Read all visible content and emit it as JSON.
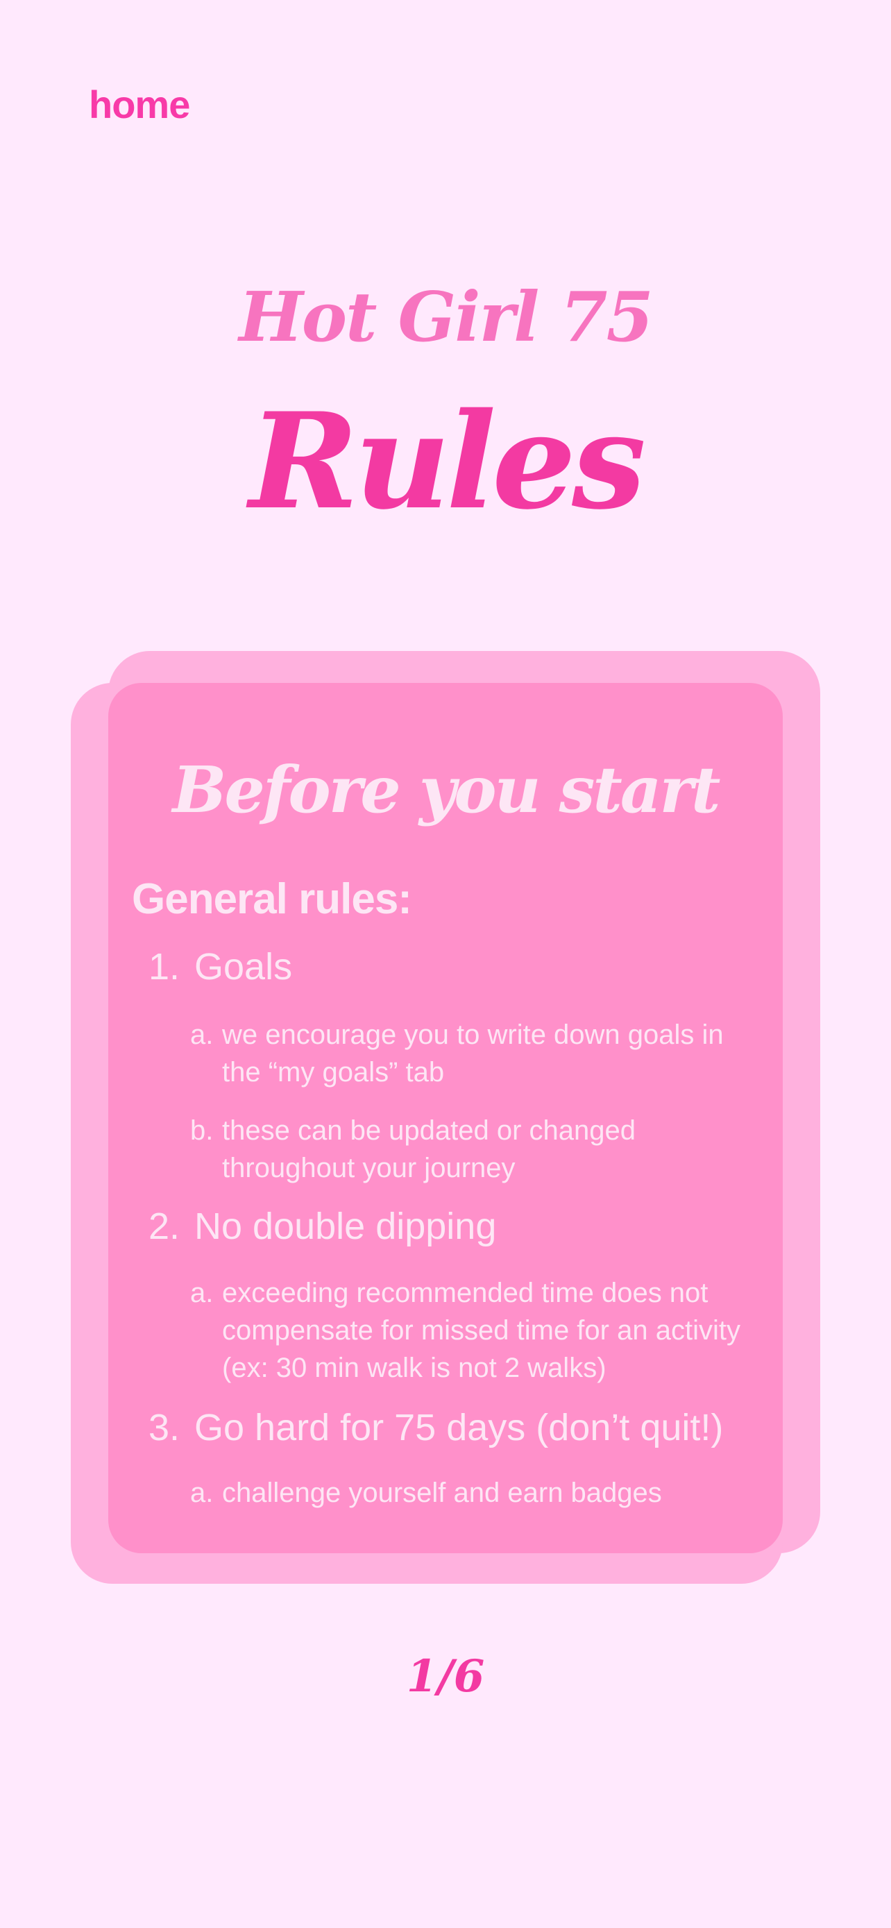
{
  "nav": {
    "home_label": "home"
  },
  "header": {
    "subtitle": "Hot Girl 75",
    "title": "Rules"
  },
  "card": {
    "heading": "Before you start",
    "section_title": "General rules:",
    "rules": [
      {
        "number": "1.",
        "label": "Goals",
        "subs": [
          {
            "letter": "a.",
            "text": "we encourage you to write down goals in the “my goals” tab"
          },
          {
            "letter": "b.",
            "text": "these can be updated or changed throughout your journey"
          }
        ]
      },
      {
        "number": "2.",
        "label": "No double dipping",
        "subs": [
          {
            "letter": "a.",
            "text": "exceeding recommended time does not compensate for missed time for an activity (ex: 30 min walk is not 2 walks)"
          }
        ]
      },
      {
        "number": "3.",
        "label": "Go hard for 75 days (don’t quit!)",
        "subs": [
          {
            "letter": "a.",
            "text": "challenge yourself and earn badges"
          }
        ]
      }
    ]
  },
  "pagination": {
    "indicator": "1/6"
  },
  "colors": {
    "background": "#ffe9fd",
    "accent": "#f33aa2",
    "card": "#ff90ca",
    "card_shadow": "#ffb1de",
    "card_text": "#fde6f5"
  }
}
